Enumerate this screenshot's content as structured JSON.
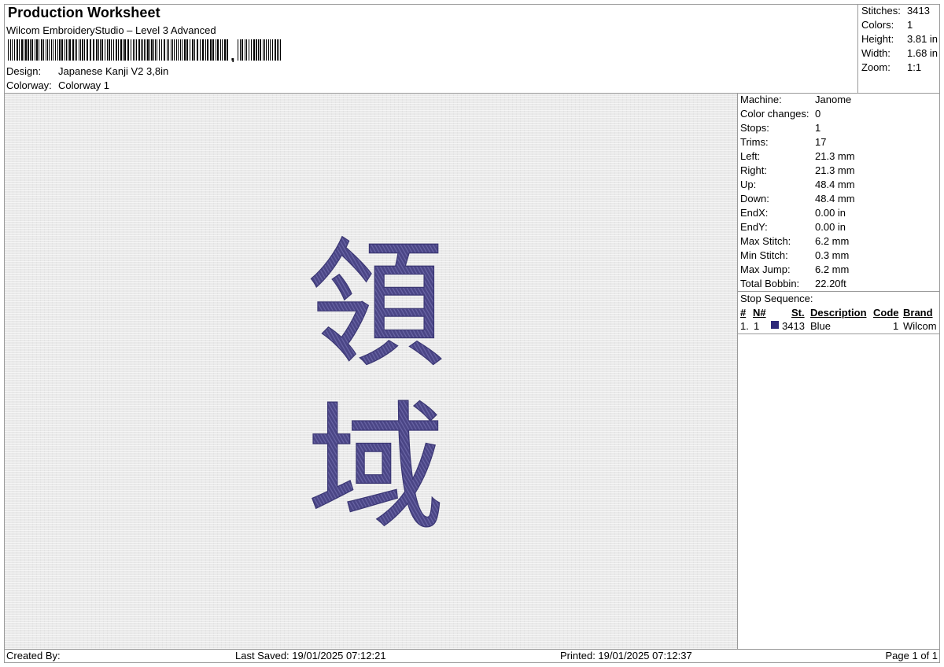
{
  "header": {
    "title": "Production Worksheet",
    "software": "Wilcom EmbroideryStudio – Level 3 Advanced",
    "design_label": "Design:",
    "design_value": "Japanese Kanji V2 3,8in",
    "colorway_label": "Colorway:",
    "colorway_value": "Colorway 1"
  },
  "summary": [
    {
      "label": "Stitches:",
      "value": "3413"
    },
    {
      "label": "Colors:",
      "value": "1"
    },
    {
      "label": "Height:",
      "value": "3.81 in"
    },
    {
      "label": "Width:",
      "value": "1.68 in"
    },
    {
      "label": "Zoom:",
      "value": "1:1"
    }
  ],
  "machine_info": [
    {
      "label": "Machine:",
      "value": "Janome"
    },
    {
      "label": "Color changes:",
      "value": "0"
    },
    {
      "label": "Stops:",
      "value": "1"
    },
    {
      "label": "Trims:",
      "value": "17"
    },
    {
      "label": "Left:",
      "value": "21.3 mm"
    },
    {
      "label": "Right:",
      "value": "21.3 mm"
    },
    {
      "label": "Up:",
      "value": "48.4 mm"
    },
    {
      "label": "Down:",
      "value": "48.4 mm"
    },
    {
      "label": "EndX:",
      "value": "0.00 in"
    },
    {
      "label": "EndY:",
      "value": "0.00 in"
    },
    {
      "label": "Max Stitch:",
      "value": "6.2 mm"
    },
    {
      "label": "Min Stitch:",
      "value": "0.3 mm"
    },
    {
      "label": "Max Jump:",
      "value": "6.2 mm"
    },
    {
      "label": "Total Bobbin:",
      "value": "22.20ft"
    }
  ],
  "stop_sequence": {
    "title": "Stop Sequence:",
    "columns": {
      "index": "#",
      "needle": "N#",
      "stitches": "St.",
      "description": "Description",
      "code": "Code",
      "brand": "Brand"
    },
    "rows": [
      {
        "index": "1.",
        "needle": "1",
        "stitches": "3413",
        "description": "Blue",
        "code": "1",
        "brand": "Wilcom",
        "color": "#2e2a7a"
      }
    ]
  },
  "design_preview": {
    "glyphs": [
      "領",
      "域"
    ],
    "thread_color": "#4a4585",
    "fabric_color": "#e9e9e9"
  },
  "footer": {
    "created_by": "Created By:",
    "last_saved": "Last Saved: 19/01/2025 07:12:21",
    "printed": "Printed: 19/01/2025 07:12:37",
    "page": "Page 1 of 1"
  }
}
